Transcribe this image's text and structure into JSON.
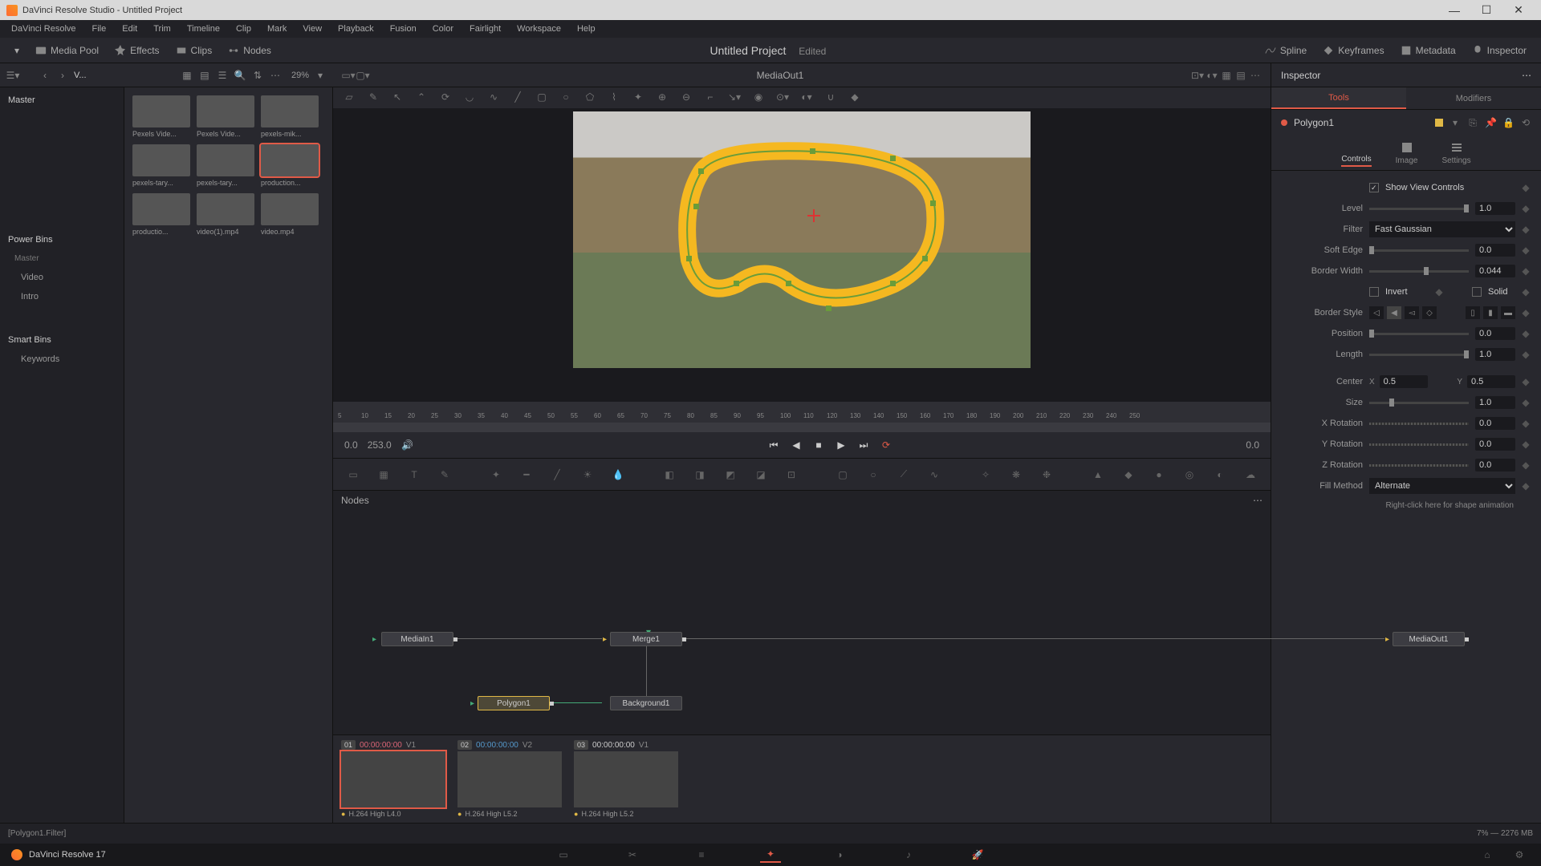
{
  "title": "DaVinci Resolve Studio - Untitled Project",
  "menu": [
    "DaVinci Resolve",
    "File",
    "Edit",
    "Trim",
    "Timeline",
    "Clip",
    "Mark",
    "View",
    "Playback",
    "Fusion",
    "Color",
    "Fairlight",
    "Workspace",
    "Help"
  ],
  "toolbar": {
    "media_pool": "Media Pool",
    "effects": "Effects",
    "clips": "Clips",
    "nodes": "Nodes",
    "project_title": "Untitled Project",
    "edited": "Edited",
    "spline": "Spline",
    "keyframes": "Keyframes",
    "metadata": "Metadata",
    "inspector": "Inspector"
  },
  "left": {
    "master": "Master",
    "power_bins": "Power Bins",
    "pb_master": "Master",
    "pb_video": "Video",
    "pb_intro": "Intro",
    "smart_bins": "Smart Bins",
    "keywords": "Keywords"
  },
  "media_head": {
    "nav_label": "V...",
    "zoom": "29%"
  },
  "thumbs": [
    {
      "label": "Pexels Vide...",
      "sel": false
    },
    {
      "label": "Pexels Vide...",
      "sel": false
    },
    {
      "label": "pexels-mik...",
      "sel": false
    },
    {
      "label": "pexels-tary...",
      "sel": false
    },
    {
      "label": "pexels-tary...",
      "sel": false
    },
    {
      "label": "production...",
      "sel": true
    },
    {
      "label": "productio...",
      "sel": false
    },
    {
      "label": "video(1).mp4",
      "sel": false
    },
    {
      "label": "video.mp4",
      "sel": false
    }
  ],
  "viewer": {
    "name": "MediaOut1",
    "tc_left": "0.0",
    "duration": "253.0",
    "tc_right": "0.0"
  },
  "ruler": [
    "5",
    "10",
    "15",
    "20",
    "25",
    "30",
    "35",
    "40",
    "45",
    "50",
    "55",
    "60",
    "65",
    "70",
    "75",
    "80",
    "85",
    "90",
    "95",
    "100",
    "110",
    "120",
    "130",
    "140",
    "150",
    "160",
    "170",
    "180",
    "190",
    "200",
    "210",
    "220",
    "230",
    "240",
    "250"
  ],
  "nodes": {
    "title": "Nodes",
    "items": {
      "media_in": "MediaIn1",
      "merge": "Merge1",
      "polygon": "Polygon1",
      "background": "Background1",
      "media_out": "MediaOut1"
    }
  },
  "clips": [
    {
      "num": "01",
      "tc": "00:00:00:00",
      "trk": "V1",
      "codec": "H.264 High L4.0",
      "sel": true,
      "tcclass": "tc"
    },
    {
      "num": "02",
      "tc": "00:00:00:00",
      "trk": "V2",
      "codec": "H.264 High L5.2",
      "sel": false,
      "tcclass": "tc2"
    },
    {
      "num": "03",
      "tc": "00:00:00:00",
      "trk": "V1",
      "codec": "H.264 High L5.2",
      "sel": false,
      "tcclass": ""
    }
  ],
  "inspector": {
    "title": "Inspector",
    "tabs": {
      "tools": "Tools",
      "modifiers": "Modifiers"
    },
    "node_name": "Polygon1",
    "subtabs": {
      "controls": "Controls",
      "image": "Image",
      "settings": "Settings"
    },
    "show_view": "Show View Controls",
    "props": {
      "level": {
        "label": "Level",
        "val": "1.0"
      },
      "filter": {
        "label": "Filter",
        "val": "Fast Gaussian"
      },
      "soft_edge": {
        "label": "Soft Edge",
        "val": "0.0"
      },
      "border_width": {
        "label": "Border Width",
        "val": "0.044"
      },
      "invert": {
        "label": "Invert"
      },
      "solid": {
        "label": "Solid"
      },
      "border_style": {
        "label": "Border Style"
      },
      "position": {
        "label": "Position",
        "val": "0.0"
      },
      "length": {
        "label": "Length",
        "val": "1.0"
      },
      "center": {
        "label": "Center",
        "x": "0.5",
        "y": "0.5"
      },
      "size": {
        "label": "Size",
        "val": "1.0"
      },
      "x_rotation": {
        "label": "X Rotation",
        "val": "0.0"
      },
      "y_rotation": {
        "label": "Y Rotation",
        "val": "0.0"
      },
      "z_rotation": {
        "label": "Z Rotation",
        "val": "0.0"
      },
      "fill_method": {
        "label": "Fill Method",
        "val": "Alternate"
      }
    },
    "shape_anim": "Right-click here for shape animation"
  },
  "status": {
    "left": "[Polygon1.Filter]",
    "right": "7% — 2276 MB",
    "app": "DaVinci Resolve 17"
  }
}
